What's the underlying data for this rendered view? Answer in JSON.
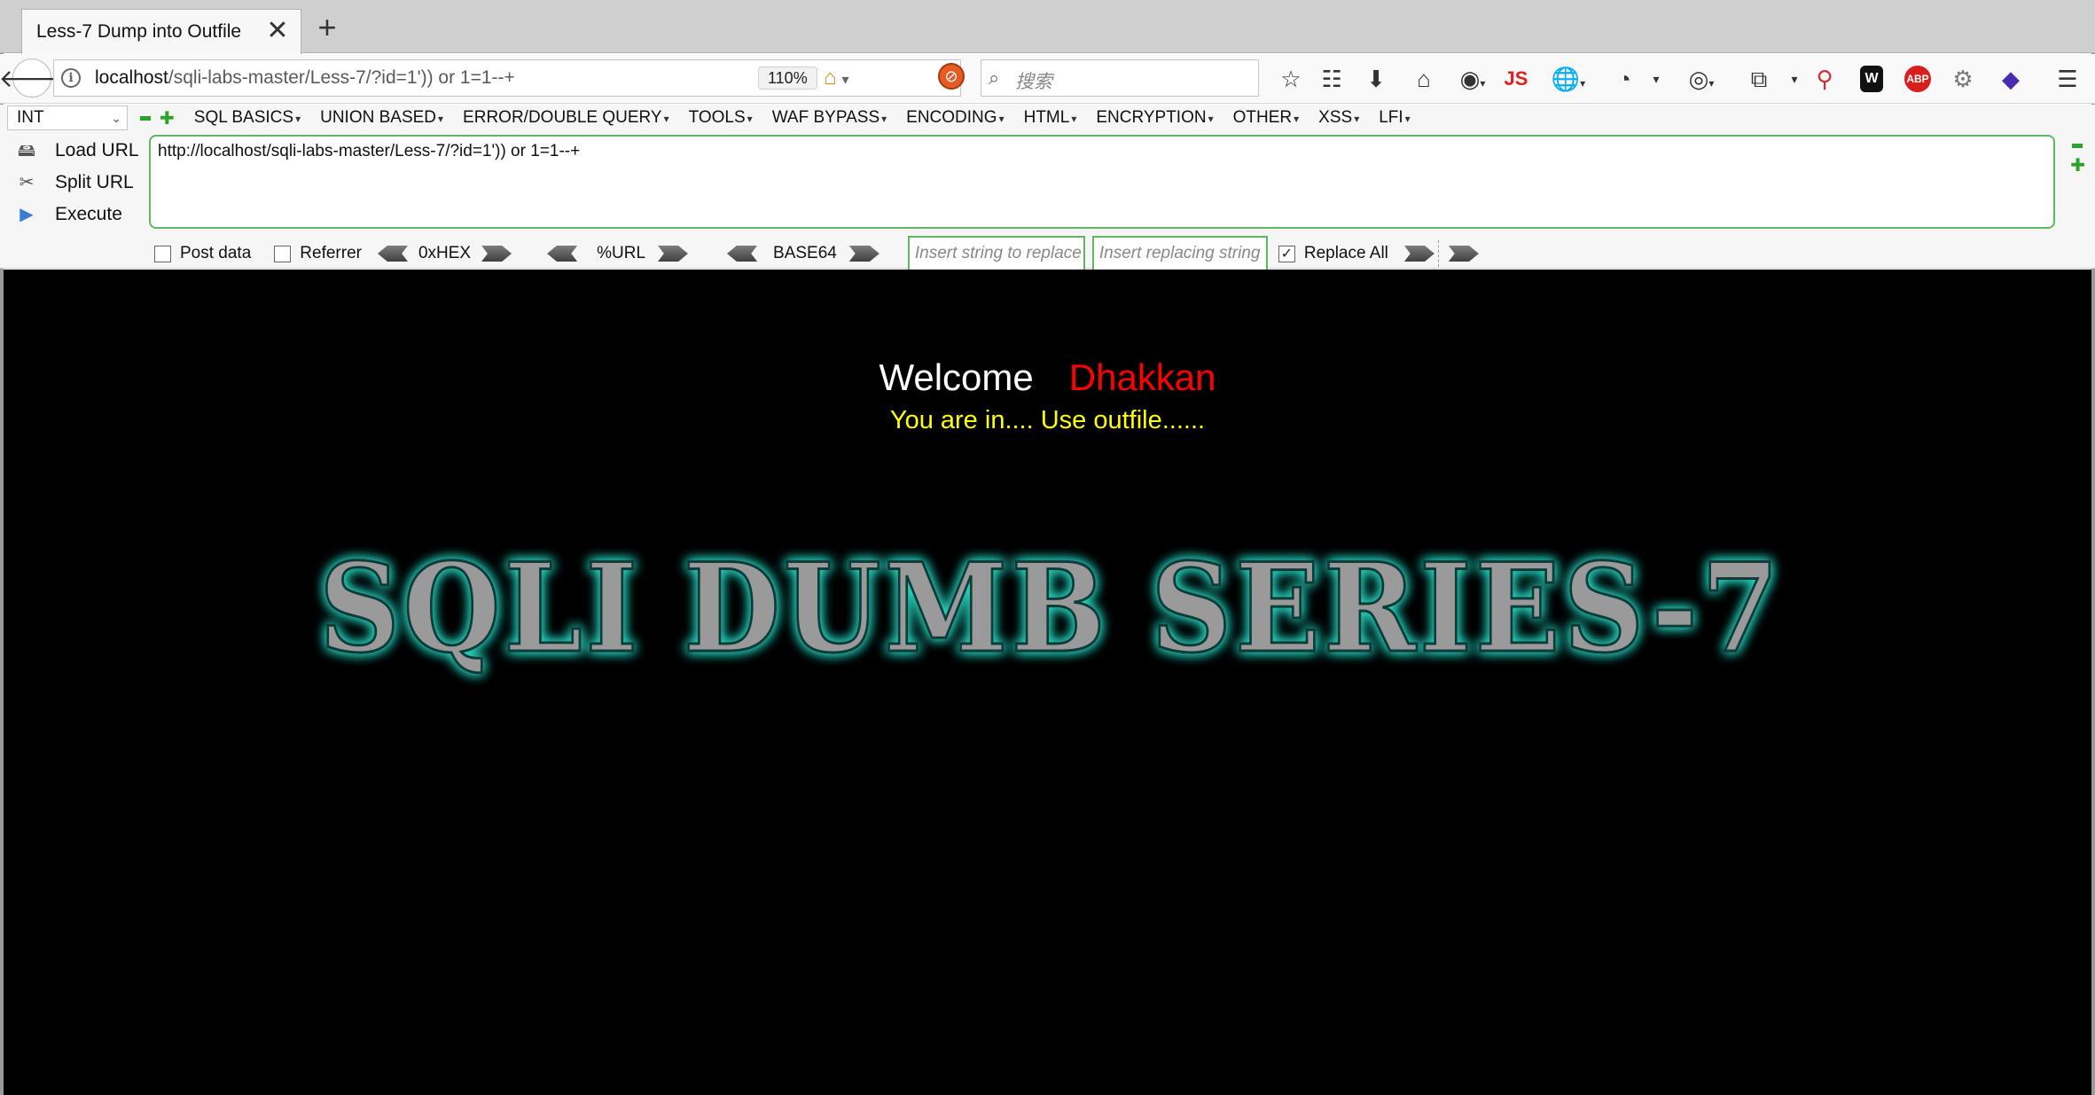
{
  "tab": {
    "title": "Less-7 Dump into Outfile",
    "close_glyph": "✕",
    "new_tab_glyph": "+"
  },
  "nav": {
    "url_host": "localhost",
    "url_path": "/sqli-labs-master/Less-7/?id=1')) or 1=1--+",
    "zoom": "110%",
    "search_placeholder": "搜索",
    "js_label": "JS",
    "abp_label": "ABP",
    "w_label": "W"
  },
  "hackbar": {
    "type_select": "INT",
    "menu": [
      "SQL BASICS",
      "UNION BASED",
      "ERROR/DOUBLE QUERY",
      "TOOLS",
      "WAF BYPASS",
      "ENCODING",
      "HTML",
      "ENCRYPTION",
      "OTHER",
      "XSS",
      "LFI"
    ],
    "actions": {
      "load_url": "Load URL",
      "split_url": "Split URL",
      "execute": "Execute"
    },
    "url_value": "http://localhost/sqli-labs-master/Less-7/?id=1')) or 1=1--+",
    "post_data_label": "Post data",
    "referrer_label": "Referrer",
    "hex_label": "0xHEX",
    "url_label": "%URL",
    "base64_label": "BASE64",
    "replace_from_placeholder": "Insert string to replace",
    "replace_to_placeholder": "Insert replacing string",
    "replace_all_label": "Replace All",
    "replace_all_checked": true
  },
  "page": {
    "welcome": "Welcome",
    "name": "Dhakkan",
    "status": "You are in.... Use outfile......",
    "banner": "SQLI DUMB SERIES-7",
    "colors": {
      "background": "#000000",
      "welcome": "#ffffff",
      "name": "#ff0000",
      "status": "#ffff00",
      "banner_glow": "#27d6c2"
    }
  }
}
